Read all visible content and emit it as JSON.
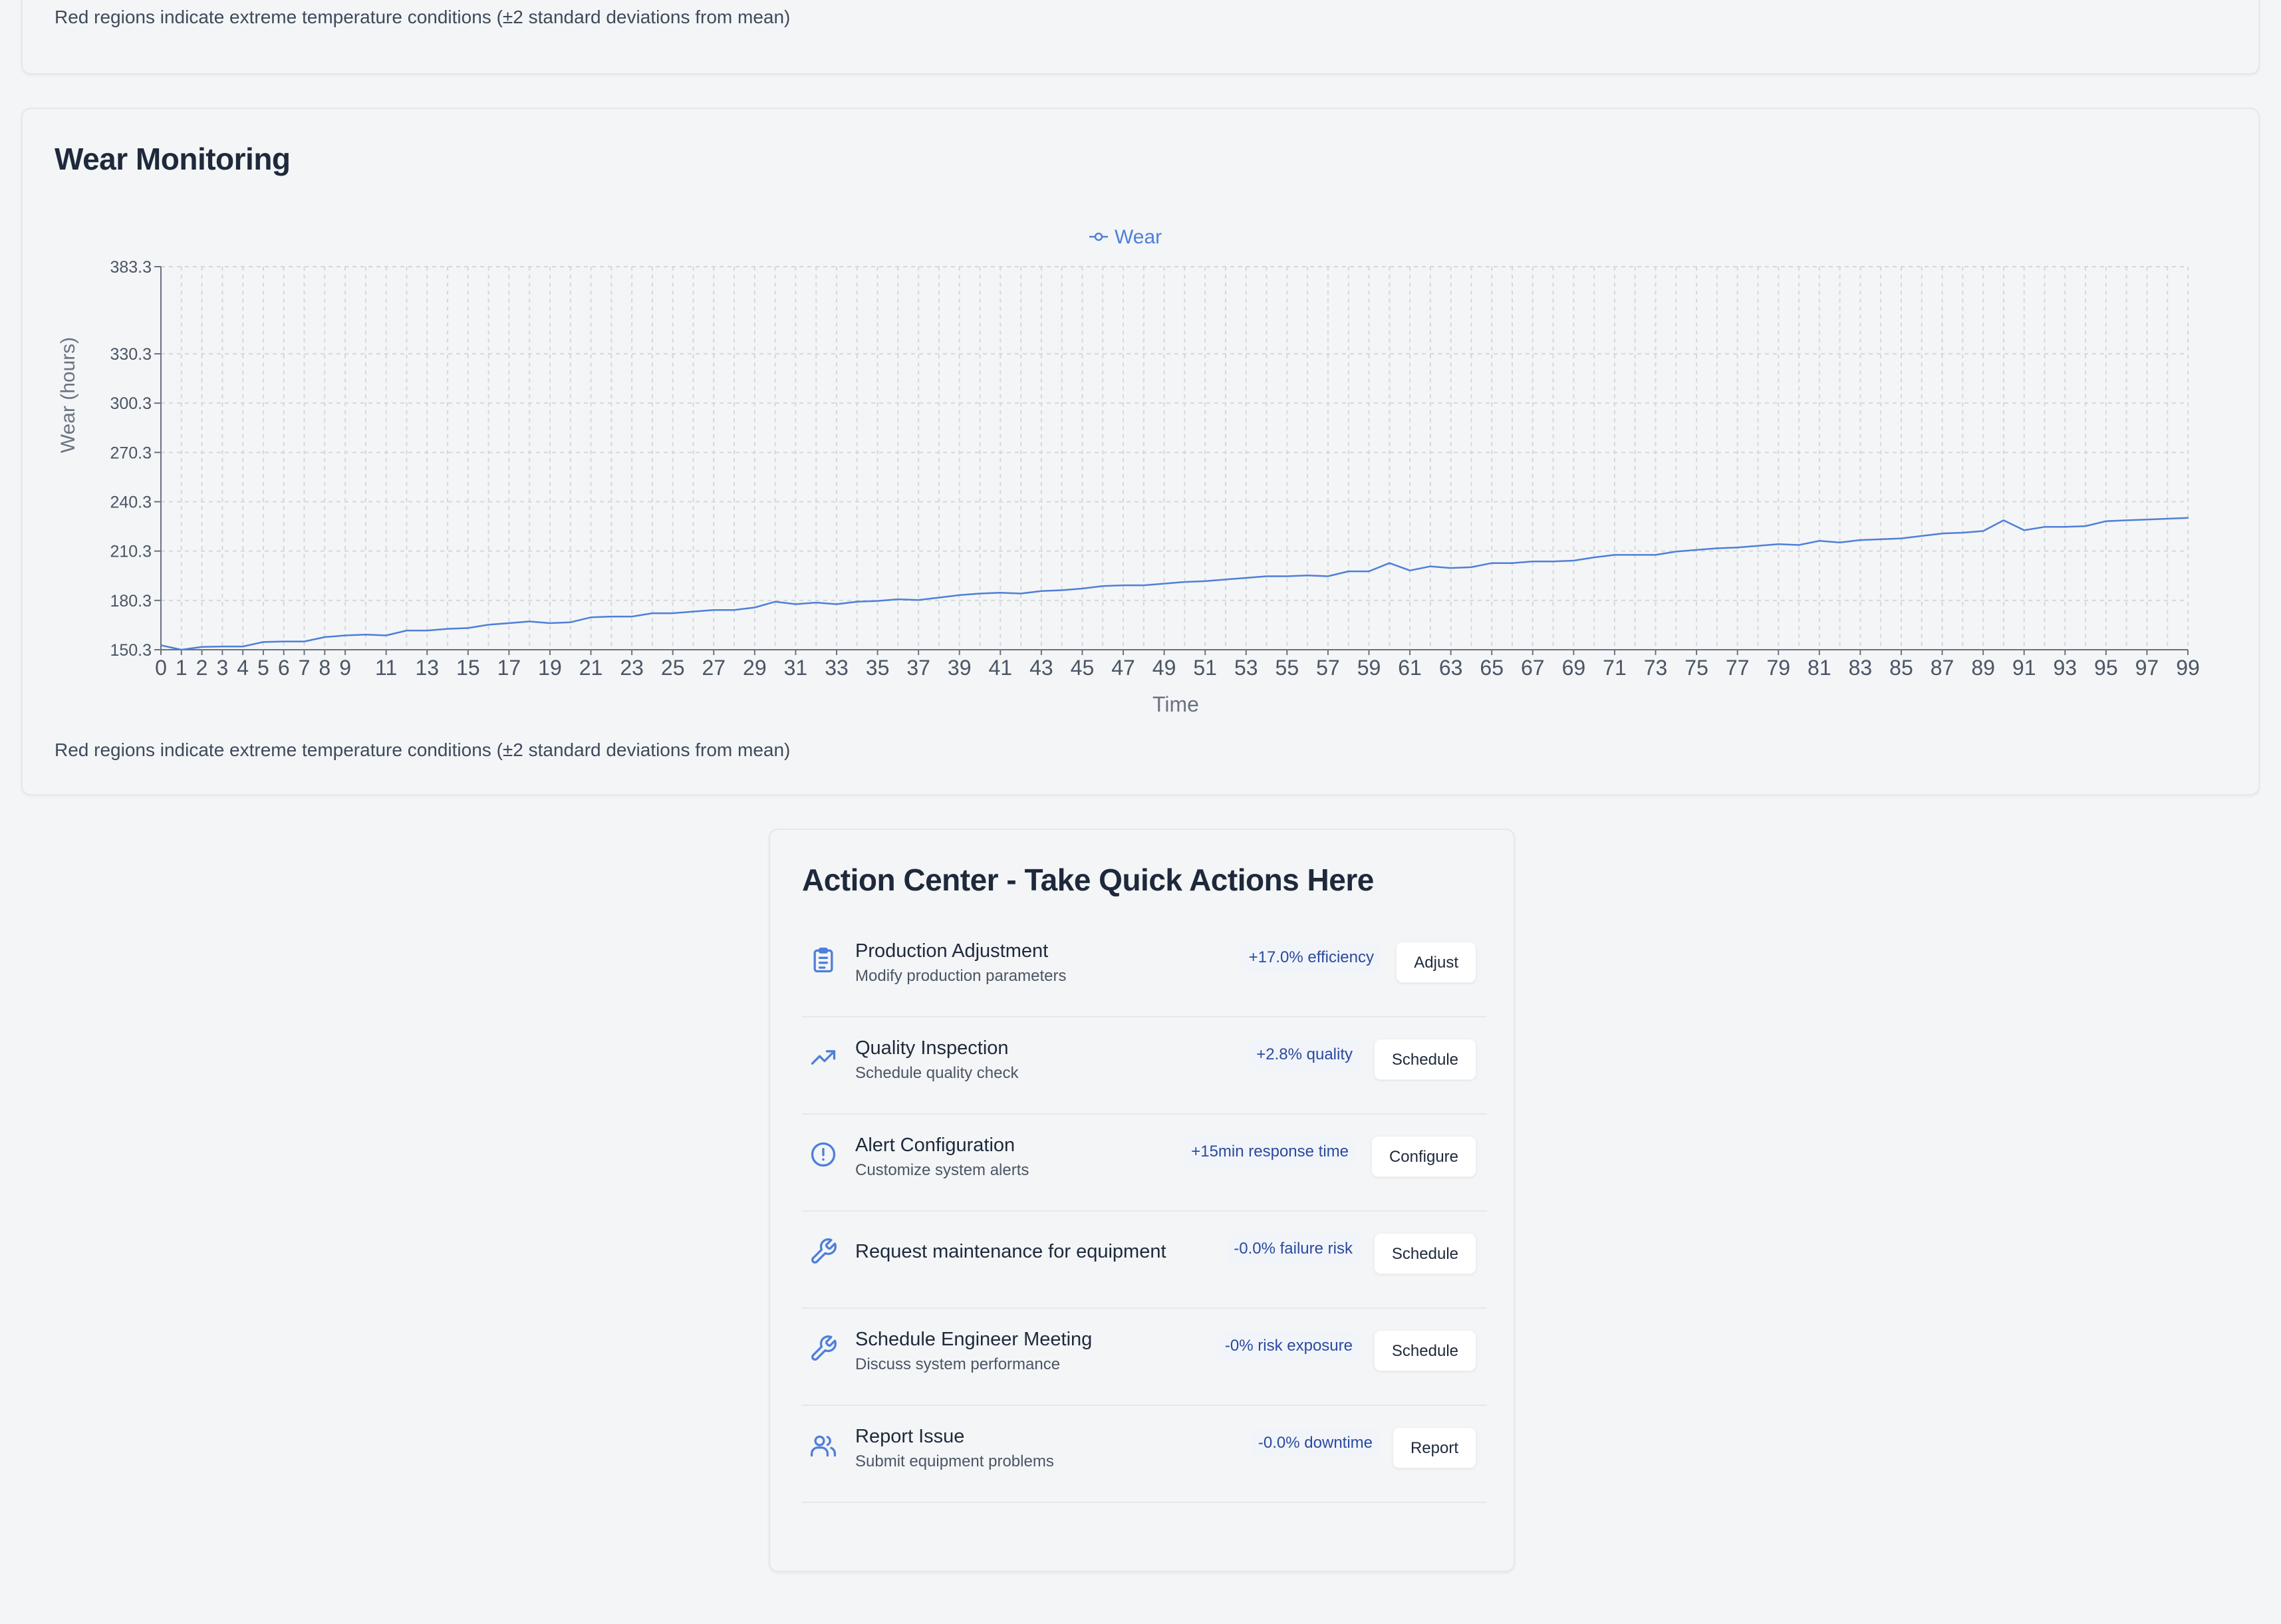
{
  "top_card": {
    "footnote": "Red regions indicate extreme temperature conditions (±2 standard deviations from mean)"
  },
  "wear_card": {
    "title": "Wear Monitoring",
    "footnote": "Red regions indicate extreme temperature conditions (±2 standard deviations from mean)"
  },
  "chart_data": {
    "type": "line",
    "legend": [
      "Wear"
    ],
    "legend_position": "top-center",
    "xlabel": "Time",
    "ylabel": "Wear (hours)",
    "y_ticks": [
      150.3,
      180.3,
      210.3,
      240.3,
      270.3,
      300.3,
      330.3,
      383.3
    ],
    "ylim": [
      150.3,
      383.3
    ],
    "xlim": [
      0,
      99
    ],
    "x_ticks": [
      0,
      1,
      2,
      3,
      4,
      5,
      6,
      7,
      8,
      9,
      11,
      13,
      15,
      17,
      19,
      21,
      23,
      25,
      27,
      29,
      31,
      33,
      35,
      37,
      39,
      41,
      43,
      45,
      47,
      49,
      51,
      53,
      55,
      57,
      59,
      61,
      63,
      65,
      67,
      69,
      71,
      73,
      75,
      77,
      79,
      81,
      83,
      85,
      87,
      89,
      91,
      93,
      95,
      97,
      99
    ],
    "grid": true,
    "colors": {
      "series": "#4f7fd8",
      "grid": "#d4d8de",
      "axis": "#6b7280"
    },
    "series": [
      {
        "name": "Wear",
        "x": [
          0,
          1,
          2,
          3,
          4,
          5,
          6,
          7,
          8,
          9,
          10,
          11,
          12,
          13,
          14,
          15,
          16,
          17,
          18,
          19,
          20,
          21,
          22,
          23,
          24,
          25,
          26,
          27,
          28,
          29,
          30,
          31,
          32,
          33,
          34,
          35,
          36,
          37,
          38,
          39,
          40,
          41,
          42,
          43,
          44,
          45,
          46,
          47,
          48,
          49,
          50,
          51,
          52,
          53,
          54,
          55,
          56,
          57,
          58,
          59,
          60,
          61,
          62,
          63,
          64,
          65,
          66,
          67,
          68,
          69,
          70,
          71,
          72,
          73,
          74,
          75,
          76,
          77,
          78,
          79,
          80,
          81,
          82,
          83,
          84,
          85,
          86,
          87,
          88,
          89,
          90,
          91,
          92,
          93,
          94,
          95,
          96,
          97,
          98,
          99
        ],
        "values": [
          153,
          150.3,
          152,
          152.3,
          152.3,
          155,
          155.3,
          155.3,
          158,
          159,
          159.5,
          159,
          162,
          162,
          163,
          163.5,
          165.5,
          166.5,
          167.5,
          166.5,
          167,
          170,
          170.5,
          170.5,
          172.5,
          172.5,
          173.5,
          174.5,
          174.5,
          176,
          179.5,
          178,
          179,
          178,
          179.5,
          180,
          181,
          180.5,
          182,
          183.5,
          184.5,
          185,
          184.5,
          186,
          186.5,
          187.5,
          189,
          189.5,
          189.5,
          190.5,
          191.5,
          192,
          193,
          194,
          195,
          195,
          195.5,
          195,
          198,
          198,
          203,
          198.5,
          201,
          200,
          200.5,
          203,
          203,
          204,
          204,
          204.5,
          206.5,
          208,
          208,
          208,
          210,
          211,
          212,
          212.5,
          213.5,
          214.5,
          214,
          216.5,
          215.5,
          217,
          217.5,
          218,
          219.5,
          221,
          221.5,
          222.5,
          229,
          223,
          225,
          225,
          225.5,
          228.5,
          229,
          229.5,
          230,
          230.5
        ]
      }
    ]
  },
  "action_center": {
    "title": "Action Center - Take Quick Actions Here",
    "actions": [
      {
        "icon": "clipboard-icon",
        "title": "Production Adjustment",
        "description": "Modify production parameters",
        "metric": "+17.0% efficiency",
        "button": "Adjust"
      },
      {
        "icon": "trending-up-icon",
        "title": "Quality Inspection",
        "description": "Schedule quality check",
        "metric": "+2.8% quality",
        "button": "Schedule"
      },
      {
        "icon": "alert-circle-icon",
        "title": "Alert Configuration",
        "description": "Customize system alerts",
        "metric": "+15min response time",
        "button": "Configure"
      },
      {
        "icon": "wrench-icon",
        "title": "Request maintenance for equipment",
        "description": "",
        "metric": "-0.0% failure risk",
        "button": "Schedule"
      },
      {
        "icon": "wrench-icon",
        "title": "Schedule Engineer Meeting",
        "description": "Discuss system performance",
        "metric": "-0% risk exposure",
        "button": "Schedule"
      },
      {
        "icon": "users-icon",
        "title": "Report Issue",
        "description": "Submit equipment problems",
        "metric": "-0.0% downtime",
        "button": "Report"
      }
    ]
  }
}
